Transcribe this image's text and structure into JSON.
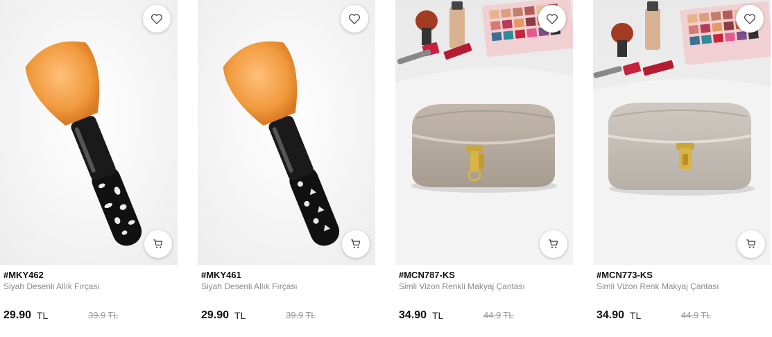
{
  "products": [
    {
      "sku": "#MKY462",
      "name": "Siyah Desenli Allık Fırçası",
      "price": "29.90",
      "currency": "TL",
      "old_price": "39.9",
      "old_currency": "TL",
      "image": "makeup-brush-leopard"
    },
    {
      "sku": "#MKY461",
      "name": "Siyah Desenli Allık Fırçası",
      "price": "29.90",
      "currency": "TL",
      "old_price": "39.9",
      "old_currency": "TL",
      "image": "makeup-brush-floral"
    },
    {
      "sku": "#MCN787-KS",
      "name": "Simli Vizon Renkli Makyaj Çantası",
      "price": "34.90",
      "currency": "TL",
      "old_price": "44.9",
      "old_currency": "TL",
      "image": "makeup-bag-mink"
    },
    {
      "sku": "#MCN773-KS",
      "name": "Simli Vizon Renk Makyaj Çantası",
      "price": "34.90",
      "currency": "TL",
      "old_price": "44.9",
      "old_currency": "TL",
      "image": "makeup-bag-mink-2"
    }
  ],
  "icons": {
    "favorite": "heart-icon",
    "cart": "shopping-cart-icon"
  }
}
